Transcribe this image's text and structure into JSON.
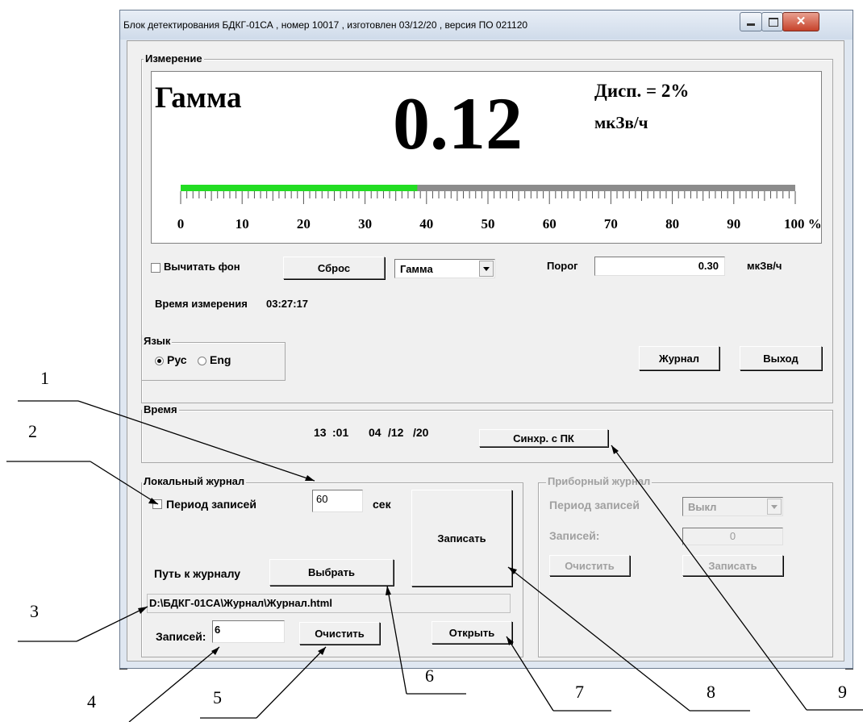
{
  "window": {
    "title": "Блок детектирования БДКГ-01СА , номер 10017 , изготовлен 03/12/20 , версия ПО 021120"
  },
  "measurement": {
    "group_label": "Измерение",
    "mode_name": "Гамма",
    "value": "0.12",
    "dispersion": "Дисп. = 2%",
    "unit": "мкЗв/ч",
    "scale_fill_percent": 38.5,
    "scale_colors": {
      "fill": "#22dd22",
      "track": "#8c8c8c"
    },
    "scale_labels": [
      "0",
      "10",
      "20",
      "30",
      "40",
      "50",
      "60",
      "70",
      "80",
      "90",
      "100 %"
    ],
    "subtract_bg_label": "Вычитать фон",
    "reset_button": "Сброс",
    "mode_select_value": "Гамма",
    "threshold_label": "Порог",
    "threshold_value": "0.30",
    "threshold_unit": "мкЗв/ч",
    "time_label": "Время измерения",
    "time_value": "03:27:17"
  },
  "language": {
    "group_label": "Язык",
    "options": [
      "Рус",
      "Eng"
    ],
    "selected": "Рус"
  },
  "actions": {
    "journal_button": "Журнал",
    "exit_button": "Выход"
  },
  "time_group": {
    "group_label": "Время",
    "hour": "13",
    "minute": ":01",
    "day": "04",
    "month": "/12",
    "year": "/20",
    "sync_button": "Синхр. с ПК"
  },
  "local_log": {
    "group_label": "Локальный журнал",
    "period_label": "Период записей",
    "period_value": "60",
    "period_unit": "сек",
    "write_button": "Записать",
    "path_label": "Путь к журналу",
    "choose_button": "Выбрать",
    "path_value": "D:\\БДКГ-01СА\\Журнал\\Журнал.html",
    "records_label": "Записей:",
    "records_value": "6",
    "clear_button": "Очистить",
    "open_button": "Открыть"
  },
  "device_log": {
    "group_label": "Приборный журнал",
    "period_label": "Период записей",
    "period_value": "Выкл",
    "records_label": "Записей:",
    "records_value": "0",
    "clear_button": "Очистить",
    "write_button": "Записать"
  },
  "callouts": [
    "1",
    "2",
    "3",
    "4",
    "5",
    "6",
    "7",
    "8",
    "9"
  ]
}
